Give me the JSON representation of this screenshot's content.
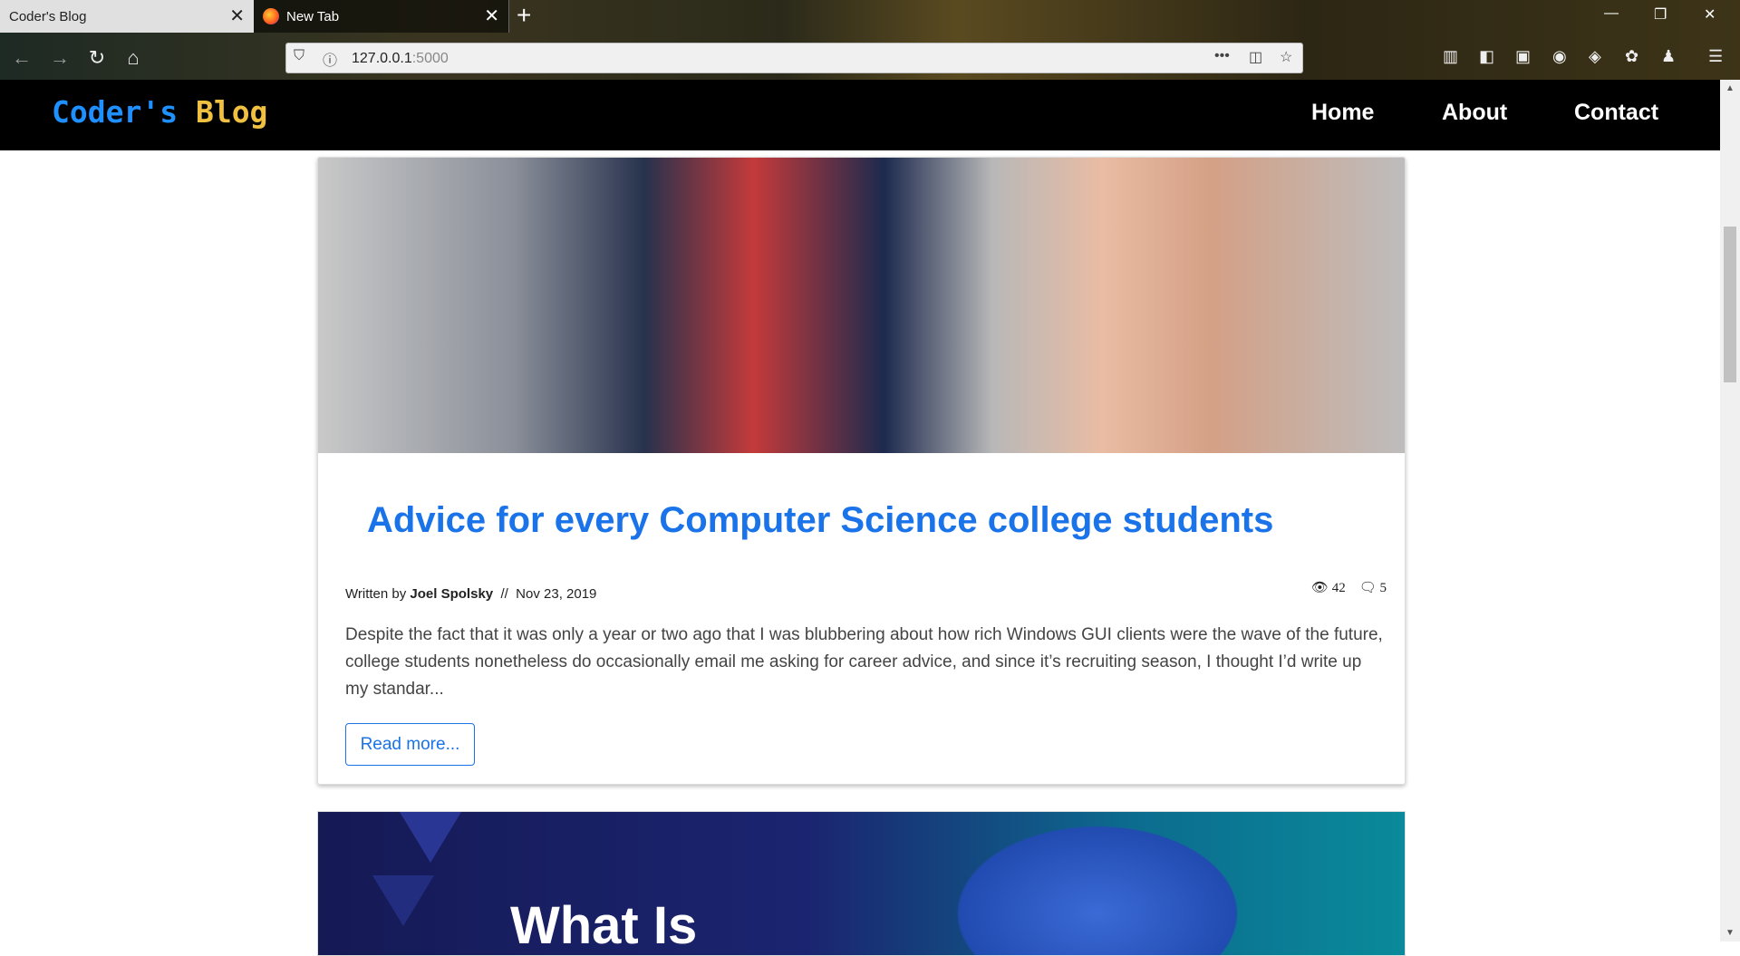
{
  "browser": {
    "tabs": [
      {
        "label": "Coder's Blog",
        "active": true
      },
      {
        "label": "New Tab",
        "active": false
      }
    ],
    "url_host": "127.0.0.1",
    "url_port": ":5000"
  },
  "site": {
    "brand_part1": "Coder's",
    "brand_part2": "Blog",
    "nav": [
      "Home",
      "About",
      "Contact"
    ]
  },
  "post": {
    "title": "Advice for every Computer Science college students",
    "written_by": "Written by",
    "author": "Joel Spolsky",
    "separator": "//",
    "date": "Nov 23, 2019",
    "views": "42",
    "comments": "5",
    "excerpt": "Despite the fact that it was only a year or two ago that I was blubbering about how rich Windows GUI clients were the wave of the future, college students nonetheless do occasionally email me asking for career advice, and since it’s recruiting season, I thought I’d write up my standar...",
    "read_more": "Read more..."
  },
  "post2": {
    "image_text": "What Is"
  },
  "colors": {
    "brand_blue": "#1e90ff",
    "brand_gold": "#f0c040",
    "link_blue": "#1a73e8",
    "header_bg": "#000000"
  }
}
